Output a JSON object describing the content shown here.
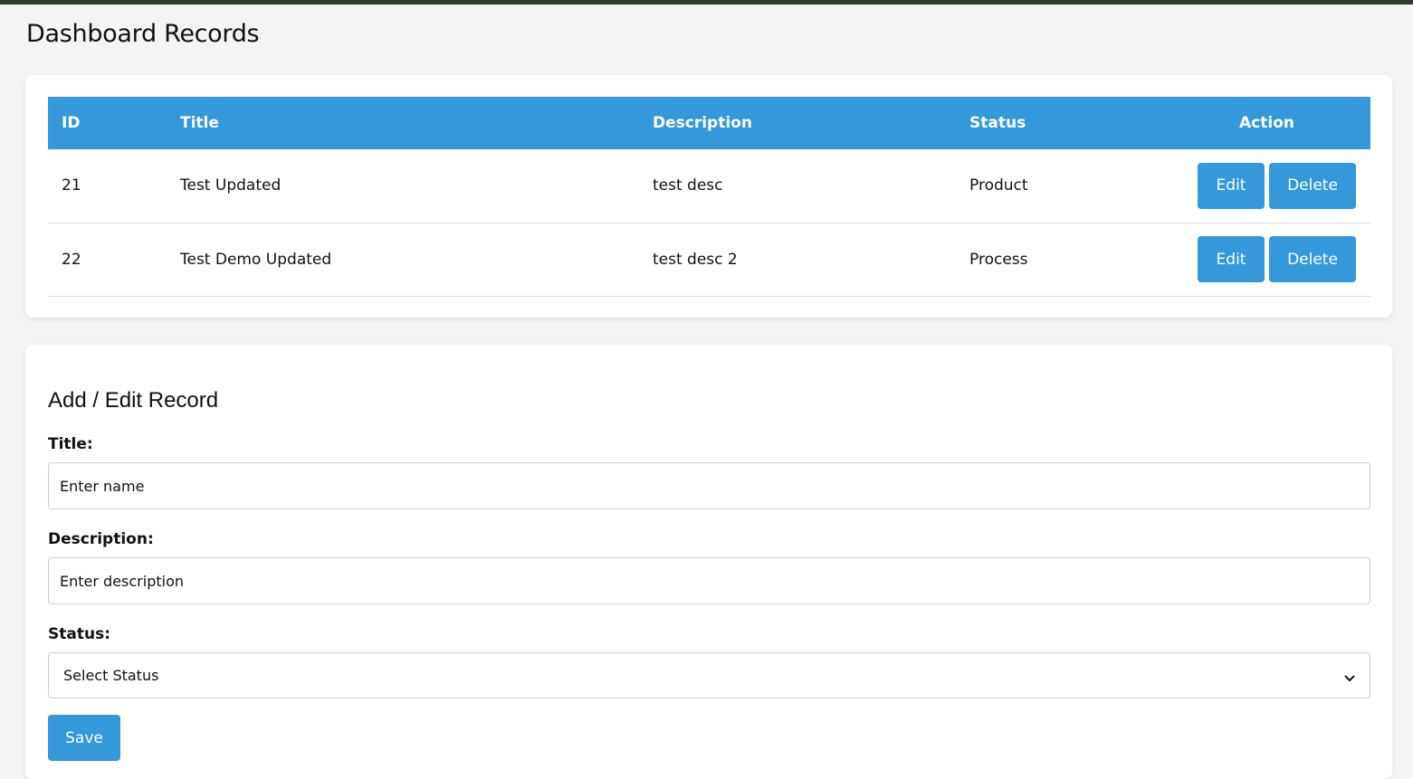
{
  "page": {
    "title": "Dashboard Records"
  },
  "table": {
    "headers": {
      "id": "ID",
      "title": "Title",
      "description": "Description",
      "status": "Status",
      "action": "Action"
    },
    "rows": [
      {
        "id": "21",
        "title": "Test Updated",
        "description": "test desc",
        "status": "Product",
        "edit_label": "Edit",
        "delete_label": "Delete"
      },
      {
        "id": "22",
        "title": "Test Demo Updated",
        "description": "test desc 2",
        "status": "Process",
        "edit_label": "Edit",
        "delete_label": "Delete"
      }
    ]
  },
  "form": {
    "heading": "Add / Edit Record",
    "title_label": "Title:",
    "title_placeholder": "Enter name",
    "title_value": "",
    "description_label": "Description:",
    "description_placeholder": "Enter description",
    "description_value": "",
    "status_label": "Status:",
    "status_selected": "Select Status",
    "save_label": "Save"
  },
  "colors": {
    "accent": "#3498db",
    "topbar": "#2f3b2a",
    "background": "#f4f4f4",
    "card": "#ffffff"
  },
  "icons": {
    "select_arrow": "chevron-down-icon"
  }
}
